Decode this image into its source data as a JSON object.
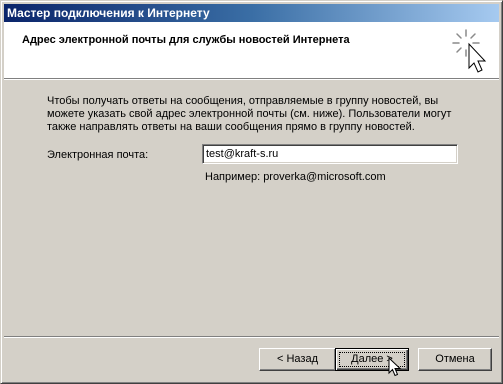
{
  "window": {
    "title": "Мастер подключения к Интернету"
  },
  "header": {
    "title": "Адрес электронной почты для службы новостей Интернета",
    "icon": "wizard-star-cursor-icon"
  },
  "main": {
    "description": "Чтобы получать ответы на сообщения, отправляемые в группу новостей, вы\nможете указать свой адрес электронной почты (см. ниже).  Пользователи могут\nтакже направлять ответы на ваши сообщения прямо в группу новостей.",
    "email_label": "Электронная почта:",
    "email_value": "test@kraft-s.ru",
    "example": "Например: proverka@microsoft.com"
  },
  "buttons": {
    "back": "< Назад",
    "next": "Далее >",
    "cancel": "Отмена"
  },
  "colors": {
    "titlebar_start": "#0a246a",
    "titlebar_end": "#a6caf0",
    "dialog_bg": "#d4d0c8"
  }
}
